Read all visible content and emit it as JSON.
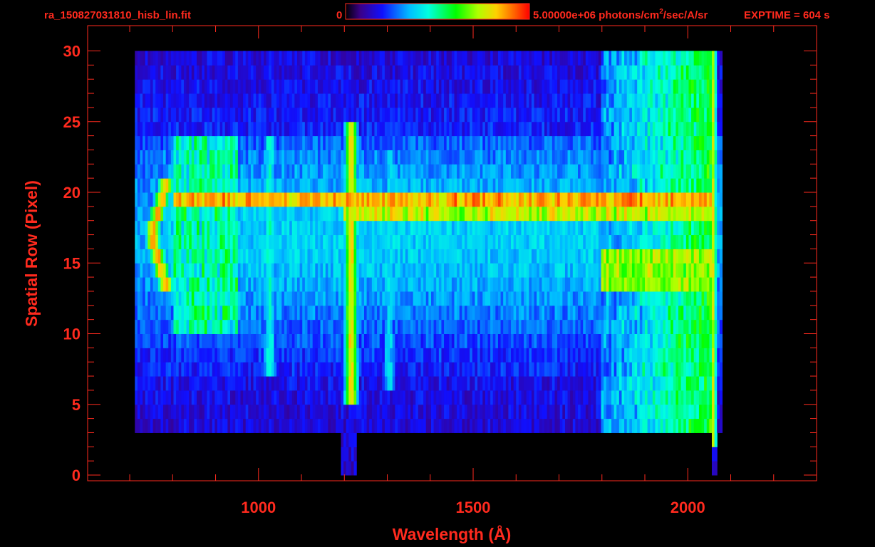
{
  "header": {
    "filename": "ra_150827031810_hisb_lin.fit",
    "colorbar_min_label": "0",
    "colorbar_max_label": "5.00000e+06 photons/cm",
    "colorbar_unit_sup": "2",
    "colorbar_unit_rest": "/sec/A/sr",
    "exptime": "EXPTIME = 604 s"
  },
  "chart_data": {
    "type": "heatmap",
    "title": "",
    "xlabel": "Wavelength (Å)",
    "ylabel": "Spatial Row (Pixel)",
    "xlim": [
      530,
      2300
    ],
    "ylim": [
      0,
      30
    ],
    "x_ticks": [
      1000,
      1500,
      2000
    ],
    "y_ticks": [
      0,
      5,
      10,
      15,
      20,
      25,
      30
    ],
    "colorbar": {
      "min": 0,
      "max": 5000000,
      "colormap": "rainbow",
      "unit": "photons/cm2/sec/A/sr"
    },
    "data_extent": {
      "x_min": 700,
      "x_max": 2070,
      "row_min": 0,
      "row_max": 30
    },
    "features": [
      {
        "name": "bright-row-band",
        "rows": [
          19,
          20
        ],
        "x_range": [
          800,
          2060
        ],
        "level": 0.85
      },
      {
        "name": "row-18-band",
        "rows": [
          18,
          19
        ],
        "x_range": [
          1200,
          2060
        ],
        "level": 0.75
      },
      {
        "name": "row-13-16-band",
        "rows": [
          13,
          16
        ],
        "x_range": [
          1800,
          2060
        ],
        "level": 0.7
      },
      {
        "name": "emission-line-1216",
        "x": 1216,
        "rows": [
          5,
          25
        ],
        "level": 0.8
      },
      {
        "name": "arc-left",
        "x": 750,
        "rows": [
          13,
          21
        ],
        "level": 0.85
      },
      {
        "name": "line-1026",
        "x": 1026,
        "rows": [
          7,
          24
        ],
        "level": 0.45
      },
      {
        "name": "line-1304",
        "x": 1304,
        "rows": [
          6,
          23
        ],
        "level": 0.4
      },
      {
        "name": "continuum-rise-red",
        "x_range": [
          1800,
          2060
        ],
        "rows": [
          3,
          30
        ],
        "level": 0.55
      },
      {
        "name": "edge-2060",
        "x": 2060,
        "rows": [
          2,
          30
        ],
        "level": 0.75
      }
    ]
  }
}
